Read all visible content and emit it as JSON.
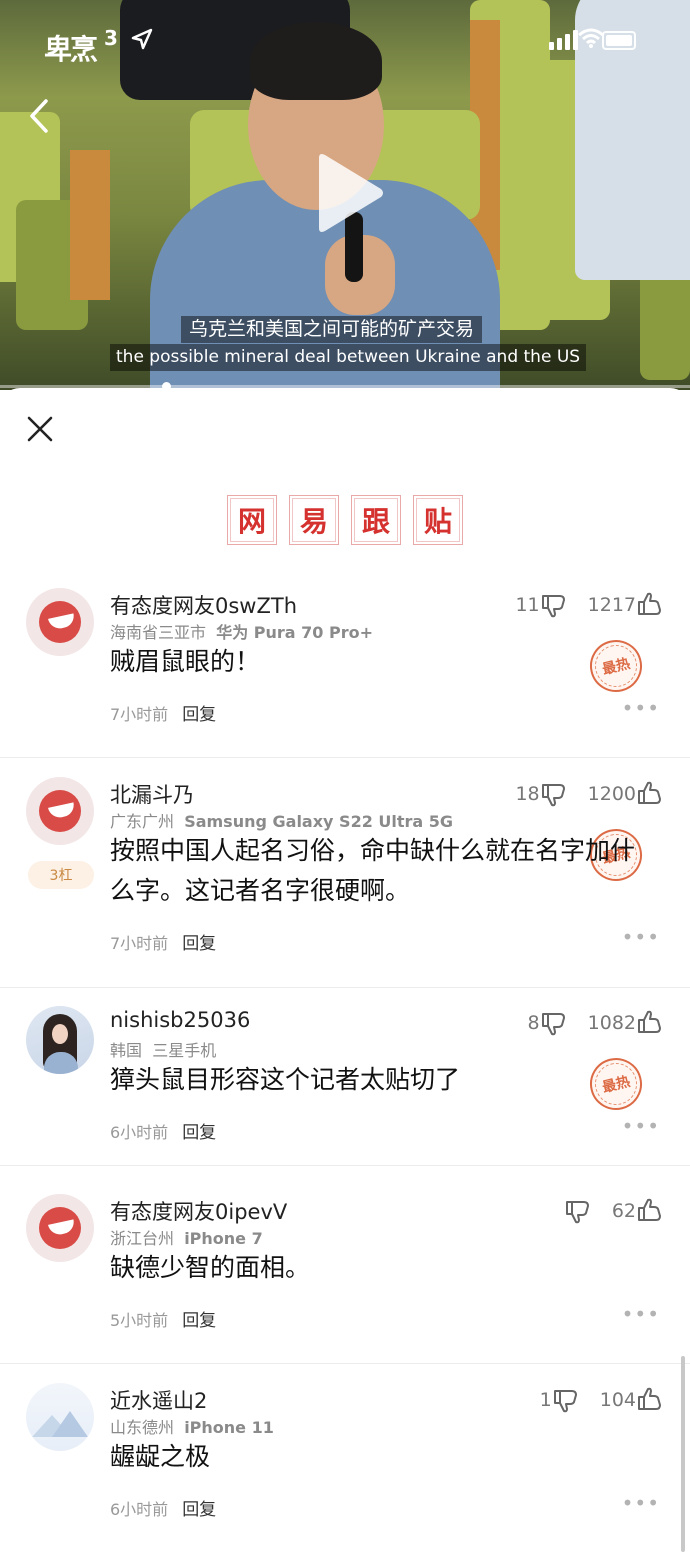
{
  "status_bar": {
    "logo": "卑烹",
    "time_fragment": "3"
  },
  "video": {
    "subtitle_cn": "乌克兰和美国之间可能的矿产交易",
    "subtitle_en": "the possible mineral deal between Ukraine and the US",
    "progress": 0.24
  },
  "comments_panel": {
    "title_chars": [
      "网",
      "易",
      "跟",
      "贴"
    ],
    "reply_label": "回复",
    "more_label": "•••",
    "hot_label": "最热",
    "comments": [
      {
        "name": "有态度网友0swZTh",
        "location": "海南省三亚市",
        "device": "华为 Pura 70 Pro+",
        "text": "贼眉鼠眼的！",
        "time": "7小时前",
        "down": "11",
        "up": "1217"
      },
      {
        "name": "北漏斗乃",
        "location": "广东广州",
        "device": "Samsung Galaxy S22 Ultra 5G",
        "badge": "3杠",
        "text": "按照中国人起名习俗，命中缺什么就在名字加什么字。这记者名字很硬啊。",
        "time": "7小时前",
        "down": "18",
        "up": "1200"
      },
      {
        "name": "nishisb25036",
        "location": "韩国",
        "device": "三星手机",
        "text": "獐头鼠目形容这个记者太贴切了",
        "time": "6小时前",
        "down": "8",
        "up": "1082"
      },
      {
        "name": "有态度网友0ipevV",
        "location": "浙江台州",
        "device": "iPhone 7",
        "text": "缺德少智的面相。",
        "time": "5小时前",
        "down": "",
        "up": "62"
      },
      {
        "name": "近水遥山2",
        "location": "山东德州",
        "device": "iPhone 11",
        "text": "龌龊之极",
        "time": "6小时前",
        "down": "1",
        "up": "104"
      }
    ]
  }
}
